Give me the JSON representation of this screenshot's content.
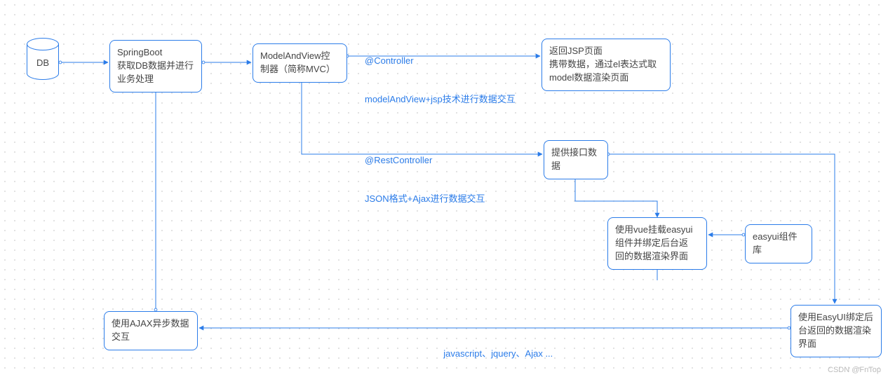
{
  "nodes": {
    "db": {
      "label": "DB"
    },
    "springboot": {
      "line1": "SpringBoot",
      "line2": "获取DB数据并进行",
      "line3": "业务处理"
    },
    "mvc": {
      "line1": "ModelAndView控",
      "line2": "制器（简称MVC）"
    },
    "jsp": {
      "line1": "返回JSP页面",
      "line2": "携带数据，通过el表达式取",
      "line3": "model数据渲染页面"
    },
    "api": {
      "line1": "提供接口数据"
    },
    "vue": {
      "line1": "使用vue挂载easyui",
      "line2": "组件并绑定后台返",
      "line3": "回的数据渲染界面"
    },
    "easyui_lib": {
      "line1": "easyui组件库"
    },
    "easyui_bind": {
      "line1": "使用EasyUI绑定后",
      "line2": "台返回的数据渲染",
      "line3": "界面"
    },
    "ajax": {
      "line1": "使用AJAX异步数据",
      "line2": "交互"
    }
  },
  "edges": {
    "controller": {
      "line1": "@Controller",
      "line2": "modelAndView+jsp技术进行数据交互"
    },
    "rest": {
      "line1": "@RestController",
      "line2": "JSON格式+Ajax进行数据交互"
    },
    "js": {
      "line1": "javascript、jquery、Ajax ..."
    }
  },
  "watermark": "CSDN @FnTop",
  "colors": {
    "stroke": "#2b7ce9"
  }
}
